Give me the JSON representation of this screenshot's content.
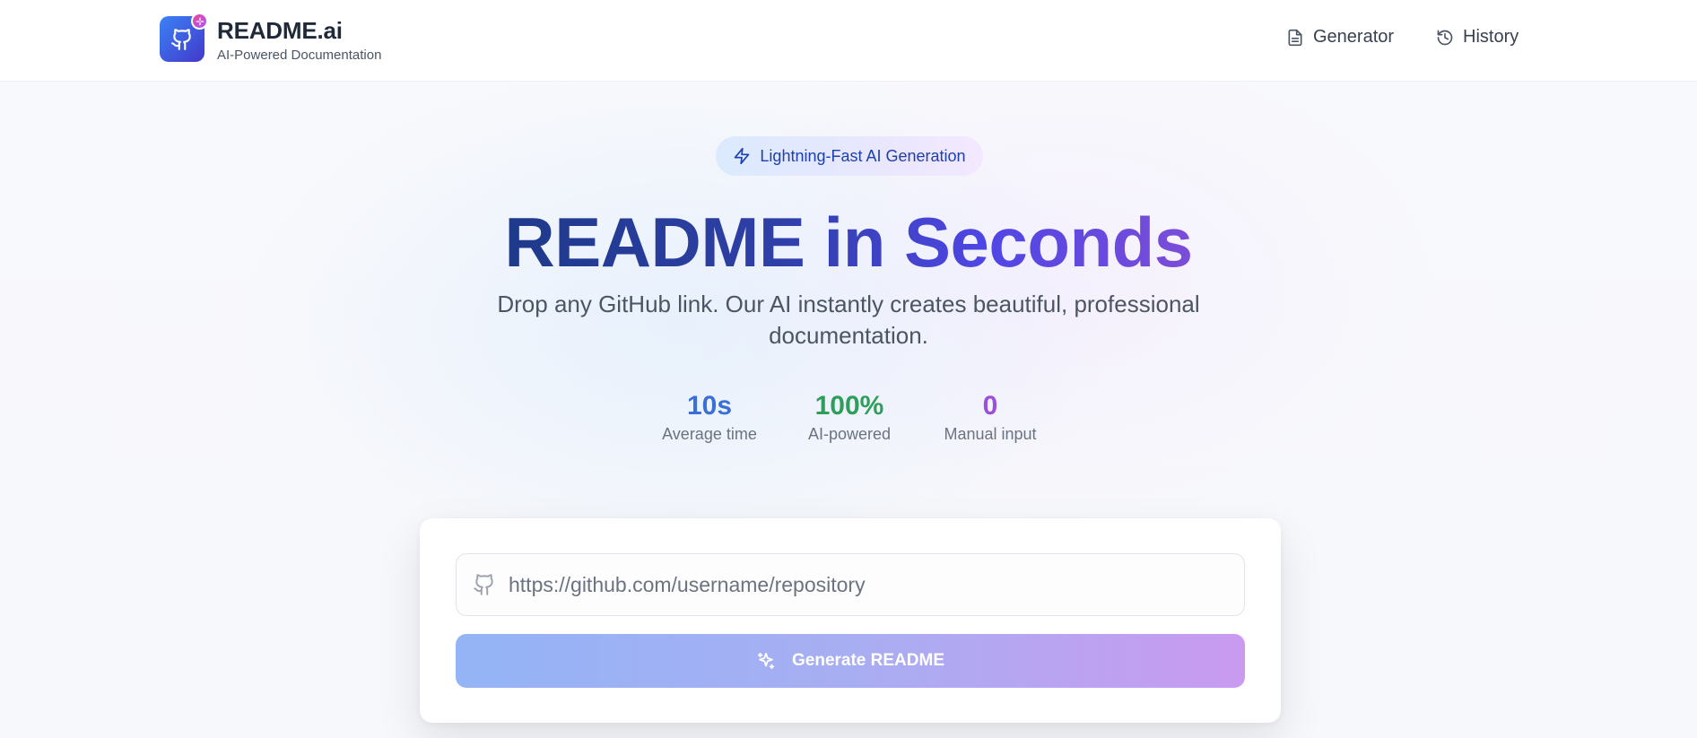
{
  "header": {
    "brand_title": "README.ai",
    "brand_subtitle": "AI-Powered Documentation",
    "nav": [
      {
        "label": "Generator",
        "icon": "document-icon"
      },
      {
        "label": "History",
        "icon": "history-icon"
      }
    ]
  },
  "hero": {
    "pill_label": "Lightning-Fast AI Generation",
    "title": "README in Seconds",
    "description": "Drop any GitHub link. Our AI instantly creates beautiful, professional documentation."
  },
  "stats": [
    {
      "value": "10s",
      "label": "Average time",
      "color": "#3b6fd8"
    },
    {
      "value": "100%",
      "label": "AI-powered",
      "color": "#2f9e5b"
    },
    {
      "value": "0",
      "label": "Manual input",
      "color": "#9b4fd9"
    }
  ],
  "form": {
    "url_placeholder": "https://github.com/username/repository",
    "url_value": "",
    "generate_label": "Generate README"
  },
  "colors": {
    "brand_blue": "#3b82f6",
    "brand_indigo": "#4338ca",
    "accent_pink": "#ec4899"
  }
}
